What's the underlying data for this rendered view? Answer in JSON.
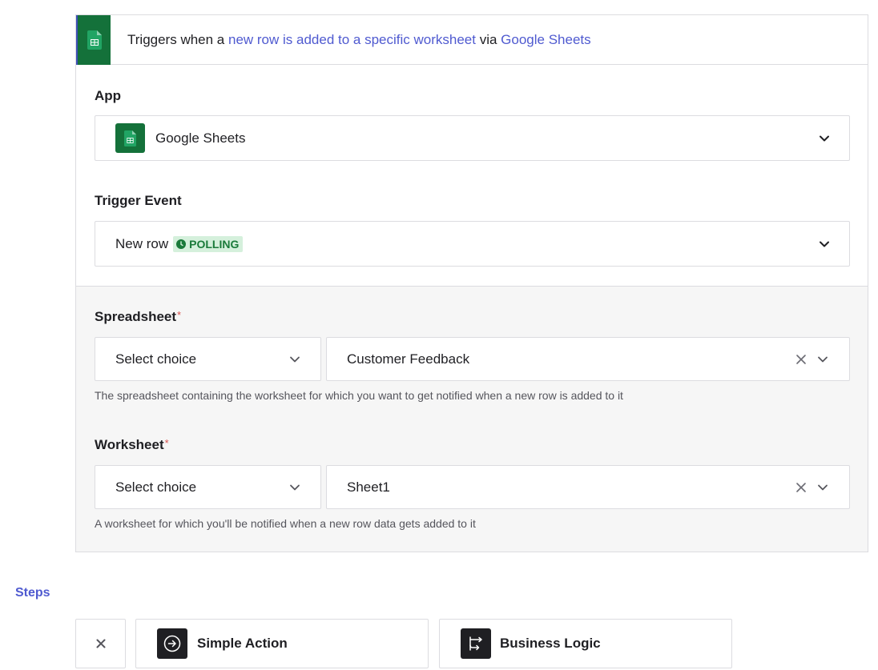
{
  "trigger": {
    "prefix": "Triggers when a ",
    "event_link": "new row is added to a specific worksheet",
    "via": " via ",
    "app_link": "Google Sheets",
    "icon": "google-sheets-icon"
  },
  "app": {
    "label": "App",
    "value": "Google Sheets",
    "icon": "google-sheets-icon"
  },
  "trigger_event": {
    "label": "Trigger Event",
    "value": "New row",
    "badge": "POLLING"
  },
  "spreadsheet": {
    "label": "Spreadsheet",
    "required_mark": "*",
    "mode": "Select choice",
    "value": "Customer Feedback",
    "help": "The spreadsheet containing the worksheet for which you want to get notified when a new row is added to it"
  },
  "worksheet": {
    "label": "Worksheet",
    "required_mark": "*",
    "mode": "Select choice",
    "value": "Sheet1",
    "help": "A worksheet for which you'll be notified when a new row data gets added to it"
  },
  "steps": {
    "label": "Steps",
    "close_icon": "close-icon",
    "items": [
      {
        "label": "Simple Action",
        "icon": "arrow-circle-icon"
      },
      {
        "label": "Business Logic",
        "icon": "branch-icon"
      }
    ]
  },
  "colors": {
    "accent": "#4f5ad0",
    "sheets_green": "#14713a",
    "badge_bg": "#d5f0dc",
    "badge_fg": "#1a7a3a"
  }
}
